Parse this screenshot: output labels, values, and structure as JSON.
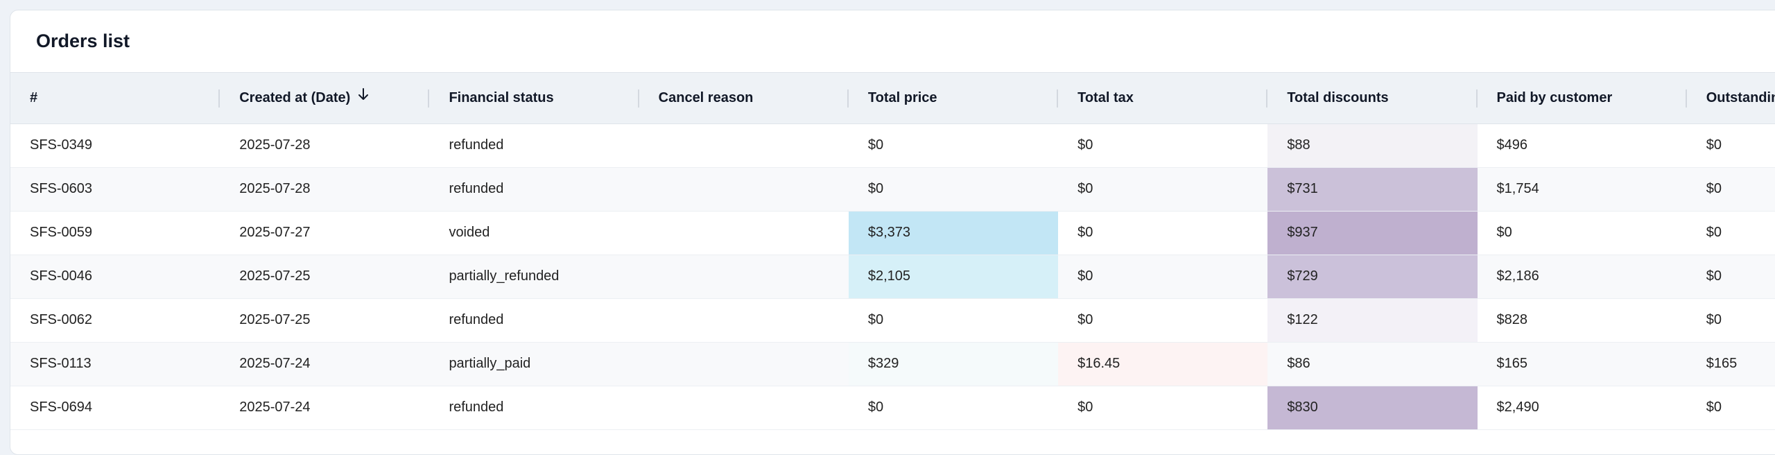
{
  "title": "Orders list",
  "columns": [
    {
      "label": "#",
      "key": "id"
    },
    {
      "label": "Created at (Date)",
      "key": "created",
      "sorted": "desc"
    },
    {
      "label": "Financial status",
      "key": "status"
    },
    {
      "label": "Cancel reason",
      "key": "cancel"
    },
    {
      "label": "Total price",
      "key": "price"
    },
    {
      "label": "Total tax",
      "key": "tax"
    },
    {
      "label": "Total discounts",
      "key": "discounts"
    },
    {
      "label": "Paid by customer",
      "key": "paid"
    },
    {
      "label": "Outstanding",
      "key": "outstanding"
    }
  ],
  "rows": [
    {
      "id": "SFS-0349",
      "created": "2025-07-28",
      "status": "refunded",
      "cancel": "",
      "price": "$0",
      "tax": "$0",
      "discounts": "$88",
      "paid": "$496",
      "outstanding": "$0",
      "heat": {
        "discounts": "#f3f2f6"
      }
    },
    {
      "id": "SFS-0603",
      "created": "2025-07-28",
      "status": "refunded",
      "cancel": "",
      "price": "$0",
      "tax": "$0",
      "discounts": "$731",
      "paid": "$1,754",
      "outstanding": "$0",
      "heat": {
        "discounts": "#cbc1d9"
      }
    },
    {
      "id": "SFS-0059",
      "created": "2025-07-27",
      "status": "voided",
      "cancel": "",
      "price": "$3,373",
      "tax": "$0",
      "discounts": "$937",
      "paid": "$0",
      "outstanding": "$0",
      "heat": {
        "price": "#c2e6f5",
        "discounts": "#bfb0cf"
      }
    },
    {
      "id": "SFS-0046",
      "created": "2025-07-25",
      "status": "partially_refunded",
      "cancel": "",
      "price": "$2,105",
      "tax": "$0",
      "discounts": "$729",
      "paid": "$2,186",
      "outstanding": "$0",
      "heat": {
        "price": "#d6f0f8",
        "discounts": "#cbc1da"
      }
    },
    {
      "id": "SFS-0062",
      "created": "2025-07-25",
      "status": "refunded",
      "cancel": "",
      "price": "$0",
      "tax": "$0",
      "discounts": "$122",
      "paid": "$828",
      "outstanding": "$0",
      "heat": {
        "discounts": "#f3f1f7"
      }
    },
    {
      "id": "SFS-0113",
      "created": "2025-07-24",
      "status": "partially_paid",
      "cancel": "",
      "price": "$329",
      "tax": "$16.45",
      "discounts": "$86",
      "paid": "$165",
      "outstanding": "$165",
      "heat": {
        "price": "#f5fafb",
        "tax": "#fdf3f3"
      }
    },
    {
      "id": "SFS-0694",
      "created": "2025-07-24",
      "status": "refunded",
      "cancel": "",
      "price": "$0",
      "tax": "$0",
      "discounts": "$830",
      "paid": "$2,490",
      "outstanding": "$0",
      "heat": {
        "discounts": "#c5b8d4"
      }
    }
  ]
}
